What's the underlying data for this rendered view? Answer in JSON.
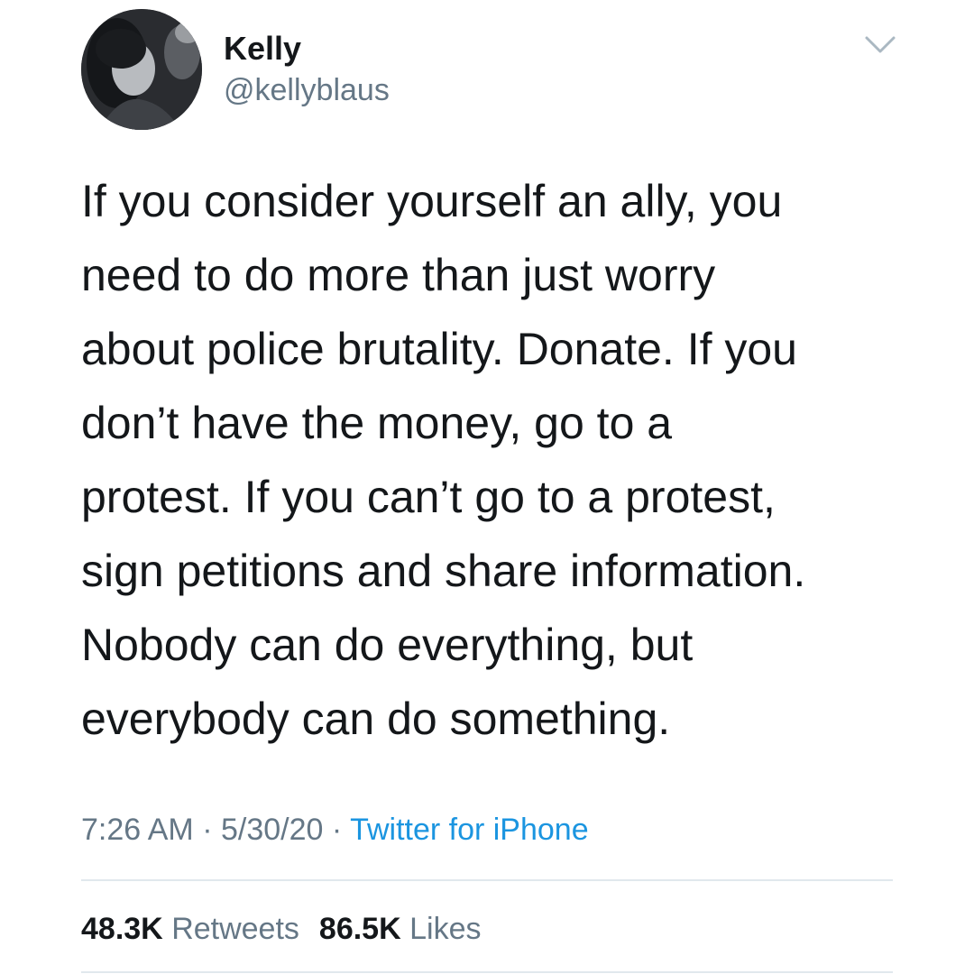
{
  "user": {
    "display_name": "Kelly",
    "handle": "@kellyblaus"
  },
  "icons": {
    "avatar": "profile-photo",
    "menu": "chevron-down-icon"
  },
  "tweet": {
    "lines": [
      "If you consider yourself an ally, you",
      "need to do more than just worry",
      "about police brutality. Donate. If you",
      "don’t have the money, go to a",
      "protest. If you can’t go to a protest,",
      "sign petitions and share information.",
      "Nobody can do everything, but",
      "everybody can do something."
    ]
  },
  "meta": {
    "time": "7:26 AM",
    "date": "5/30/20",
    "separator": "·",
    "source": "Twitter for iPhone"
  },
  "stats": {
    "retweets_count": "48.3K",
    "retweets_label": "Retweets",
    "likes_count": "86.5K",
    "likes_label": "Likes"
  },
  "colors": {
    "text": "#14171a",
    "secondary": "#657786",
    "link": "#1b95e0",
    "divider": "#e1e8ed"
  }
}
